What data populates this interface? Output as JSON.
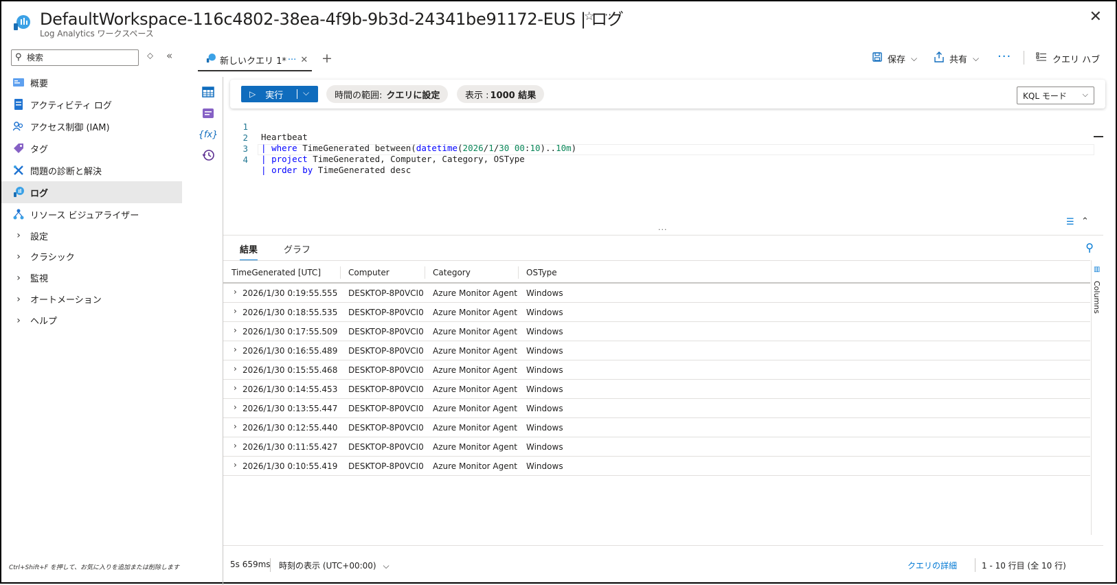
{
  "header": {
    "title": "DefaultWorkspace-116c4802-38ea-4f9b-9b3d-24341be91172-EUS | ログ",
    "subtitle": "Log Analytics ワークスペース"
  },
  "nav": {
    "search_placeholder": "検索",
    "items": [
      {
        "label": "概要"
      },
      {
        "label": "アクティビティ ログ"
      },
      {
        "label": "アクセス制御 (IAM)"
      },
      {
        "label": "タグ"
      },
      {
        "label": "問題の診断と解決"
      },
      {
        "label": "ログ"
      },
      {
        "label": "リソース ビジュアライザー"
      }
    ],
    "groups": [
      {
        "label": "設定"
      },
      {
        "label": "クラシック"
      },
      {
        "label": "監視"
      },
      {
        "label": "オートメーション"
      },
      {
        "label": "ヘルプ"
      }
    ],
    "hint": "Ctrl+Shift+F を押して、お気に入りを追加または削除します"
  },
  "tab": {
    "label": "新しいクエリ 1*",
    "dots": "···"
  },
  "toolbar": {
    "save": "保存",
    "share": "共有",
    "query_hub": "クエリ ハブ"
  },
  "query_bar": {
    "run": "実行",
    "time_range_label": "時間の範囲:",
    "time_range_value": "クエリに設定",
    "show_label": "表示 :",
    "show_value": "1000 結果",
    "mode": "KQL モード"
  },
  "editor": {
    "lines": [
      {
        "n": "1"
      },
      {
        "n": "2"
      },
      {
        "n": "3"
      },
      {
        "n": "4"
      }
    ],
    "l1": "Heartbeat",
    "l2_a": "| ",
    "l2_kw": "where",
    "l2_b": " TimeGenerated between(",
    "l2_fn": "datetime",
    "l2_c": "(",
    "l2_num": "2026",
    "l2_d": "/",
    "l2_num2": "1",
    "l2_e": "/",
    "l2_num3": "30",
    "l2_f": " ",
    "l2_num4": "00",
    "l2_g": ":",
    "l2_num5": "10",
    "l2_h": ")..",
    "l2_num6": "10m",
    "l2_i": ")",
    "l3_a": "| ",
    "l3_kw": "project",
    "l3_b": " TimeGenerated, Computer, Category, OSType",
    "l4_a": "| ",
    "l4_kw": "order by",
    "l4_b": " TimeGenerated desc"
  },
  "results": {
    "tab_results": "結果",
    "tab_chart": "グラフ",
    "columns": [
      "TimeGenerated [UTC]",
      "Computer",
      "Category",
      "OSType"
    ],
    "rows": [
      [
        "2026/1/30 0:19:55.555",
        "DESKTOP-8P0VCI0",
        "Azure Monitor Agent",
        "Windows"
      ],
      [
        "2026/1/30 0:18:55.535",
        "DESKTOP-8P0VCI0",
        "Azure Monitor Agent",
        "Windows"
      ],
      [
        "2026/1/30 0:17:55.509",
        "DESKTOP-8P0VCI0",
        "Azure Monitor Agent",
        "Windows"
      ],
      [
        "2026/1/30 0:16:55.489",
        "DESKTOP-8P0VCI0",
        "Azure Monitor Agent",
        "Windows"
      ],
      [
        "2026/1/30 0:15:55.468",
        "DESKTOP-8P0VCI0",
        "Azure Monitor Agent",
        "Windows"
      ],
      [
        "2026/1/30 0:14:55.453",
        "DESKTOP-8P0VCI0",
        "Azure Monitor Agent",
        "Windows"
      ],
      [
        "2026/1/30 0:13:55.447",
        "DESKTOP-8P0VCI0",
        "Azure Monitor Agent",
        "Windows"
      ],
      [
        "2026/1/30 0:12:55.440",
        "DESKTOP-8P0VCI0",
        "Azure Monitor Agent",
        "Windows"
      ],
      [
        "2026/1/30 0:11:55.427",
        "DESKTOP-8P0VCI0",
        "Azure Monitor Agent",
        "Windows"
      ],
      [
        "2026/1/30 0:10:55.419",
        "DESKTOP-8P0VCI0",
        "Azure Monitor Agent",
        "Windows"
      ]
    ],
    "columns_panel": "Columns"
  },
  "status": {
    "duration": "5s 659ms",
    "time_display": "時刻の表示 (UTC+00:00)",
    "query_details": "クエリの詳細",
    "range": "1 - 10 行目 (全 10 行)"
  },
  "colors": {
    "accent": "#0f6cbd",
    "link": "#0078d4"
  }
}
